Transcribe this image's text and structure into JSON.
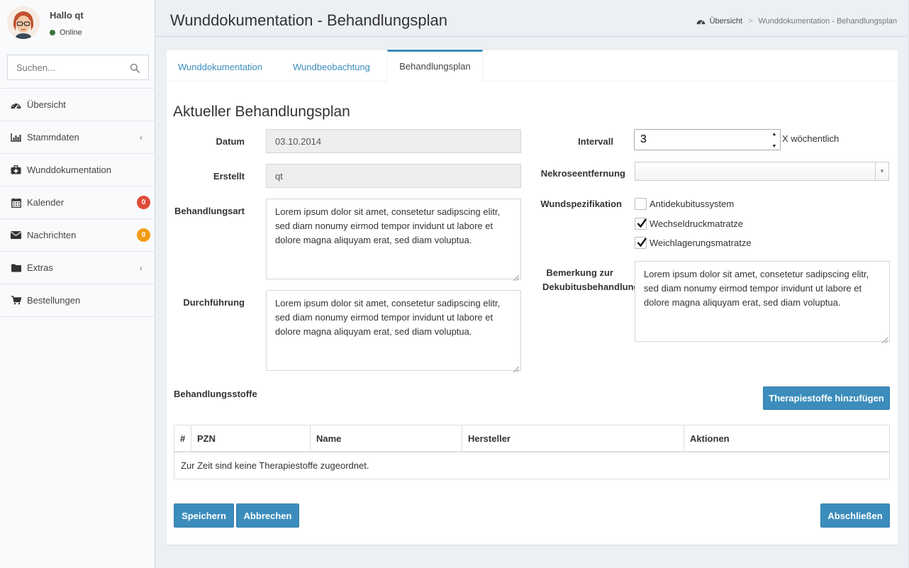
{
  "user": {
    "greeting": "Hallo qt",
    "status": "Online"
  },
  "search": {
    "placeholder": "Suchen..."
  },
  "sidebar": {
    "items": [
      {
        "label": "Übersicht",
        "icon": "dashboard-icon"
      },
      {
        "label": "Stammdaten",
        "icon": "bar-chart-icon",
        "has_submenu": true
      },
      {
        "label": "Wunddokumentation",
        "icon": "medkit-icon"
      },
      {
        "label": "Kalender",
        "icon": "calendar-icon",
        "badge": "0",
        "badge_color": "#dd4b39"
      },
      {
        "label": "Nachrichten",
        "icon": "envelope-icon",
        "badge": "0",
        "badge_color": "#f39c12"
      },
      {
        "label": "Extras",
        "icon": "folder-icon",
        "has_submenu": true
      },
      {
        "label": "Bestellungen",
        "icon": "shopping-cart-icon"
      }
    ]
  },
  "header": {
    "title": "Wunddokumentation - Behandlungsplan",
    "breadcrumb": [
      "Übersicht",
      "Wunddokumentation - Behandlungsplan"
    ]
  },
  "tabs": [
    {
      "label": "Wunddokumentation",
      "active": false
    },
    {
      "label": "Wundbeobachtung",
      "active": false
    },
    {
      "label": "Behandlungsplan",
      "active": true
    }
  ],
  "form": {
    "section_title": "Aktueller Behandlungsplan",
    "datum": {
      "label": "Datum",
      "value": "03.10.2014"
    },
    "erstellt": {
      "label": "Erstellt",
      "value": "qt"
    },
    "behandlungsart": {
      "label": "Behandlungsart",
      "value": "Lorem ipsum dolor sit amet, consetetur sadipscing elitr, sed diam nonumy eirmod tempor invidunt ut labore et dolore magna aliquyam erat, sed diam voluptua."
    },
    "durchfuehrung": {
      "label": "Durchführung",
      "value": "Lorem ipsum dolor sit amet, consetetur sadipscing elitr, sed diam nonumy eirmod tempor invidunt ut labore et dolore magna aliquyam erat, sed diam voluptua."
    },
    "intervall": {
      "label": "Intervall",
      "value": "3",
      "suffix": "X wöchentlich"
    },
    "nekrose": {
      "label": "Nekroseentfernung",
      "value": ""
    },
    "wundspezifikation": {
      "label": "Wundspezifikation",
      "options": [
        {
          "label": "Antidekubitussystem",
          "checked": false
        },
        {
          "label": "Wechseldruckmatratze",
          "checked": true
        },
        {
          "label": "Weichlagerungsmatratze",
          "checked": true
        }
      ]
    },
    "bemerkung": {
      "label_line1": "Bemerkung zur",
      "label_line2": "Dekubitusbehandlung",
      "value": "Lorem ipsum dolor sit amet, consetetur sadipscing elitr, sed diam nonumy eirmod tempor invidunt ut labore et dolore magna aliquyam erat, sed diam voluptua."
    }
  },
  "stoffe": {
    "title": "Behandlungsstoffe",
    "add_button": "Therapiestoffe hinzufügen",
    "columns": [
      "#",
      "PZN",
      "Name",
      "Hersteller",
      "Aktionen"
    ],
    "empty_text": "Zur Zeit sind keine Therapiestoffe zugeordnet."
  },
  "actions": {
    "save": "Speichern",
    "cancel": "Abbrechen",
    "finish": "Abschließen"
  },
  "colors": {
    "primary": "#3c8dbc",
    "badge_red": "#dd4b39",
    "badge_orange": "#f39c12"
  }
}
